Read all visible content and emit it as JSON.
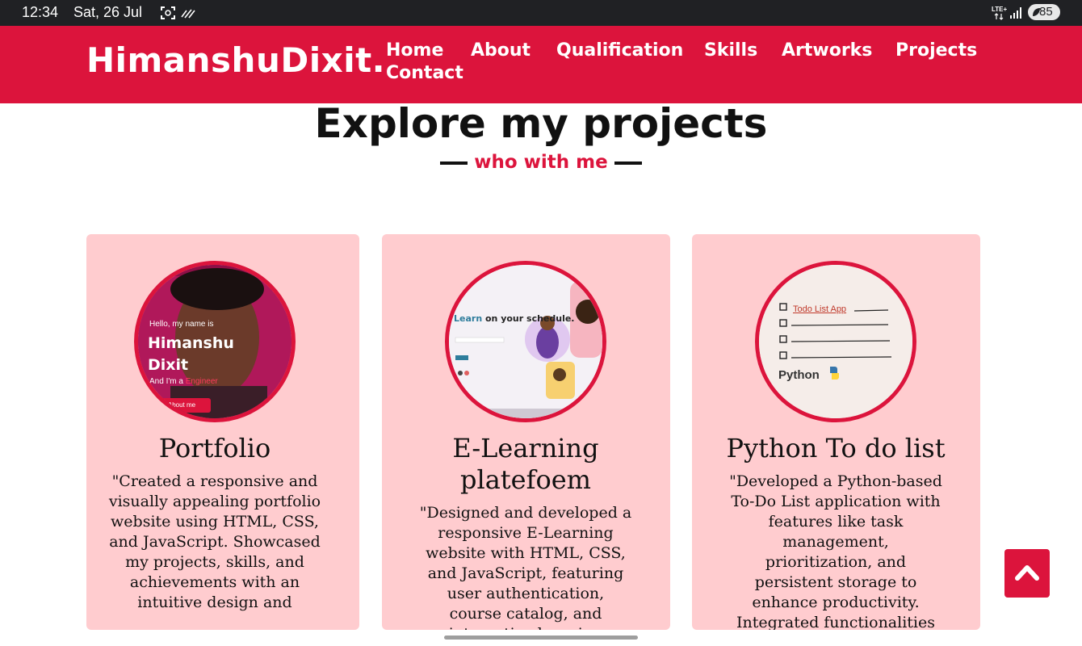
{
  "status_bar": {
    "time": "12:34",
    "date": "Sat, 26 Jul",
    "network": "LTE+",
    "battery": "85"
  },
  "header": {
    "logo": "HimanshuDixit.",
    "nav": [
      "Home",
      "About",
      "Qualification",
      "Skills",
      "Artworks",
      "Projects",
      "Contact"
    ]
  },
  "section": {
    "title": "Explore my projects",
    "subtitle": "who with me"
  },
  "projects": [
    {
      "title": "Portfolio",
      "description": "\"Created a responsive and visually appealing portfolio website using HTML, CSS, and JavaScript. Showcased my projects, skills, and achievements with an intuitive design and",
      "thumb": {
        "greeting": "Hello, my name is",
        "name": "Himanshu Dixit",
        "role_prefix": "And I'm a ",
        "role": "Engineer",
        "button": "About me"
      }
    },
    {
      "title": "E-Learning platefoem",
      "description": "\"Designed and developed a responsive E-Learning website with HTML, CSS, and JavaScript, featuring user authentication, course catalog, and interactive learning",
      "thumb": {
        "headline_highlight": "Learn",
        "headline": " on your schedule."
      }
    },
    {
      "title": "Python To do list",
      "description": "\"Developed a Python-based To-Do List application with features like task management, prioritization, and persistent storage to enhance productivity. Integrated functionalities",
      "thumb": {
        "title": "Todo List App",
        "language": "Python"
      }
    }
  ],
  "colors": {
    "accent": "#dc143c",
    "card_bg": "#ffcccf",
    "status_bar": "#202124"
  },
  "icons": {
    "scroll_top": "chevron-up-icon"
  }
}
